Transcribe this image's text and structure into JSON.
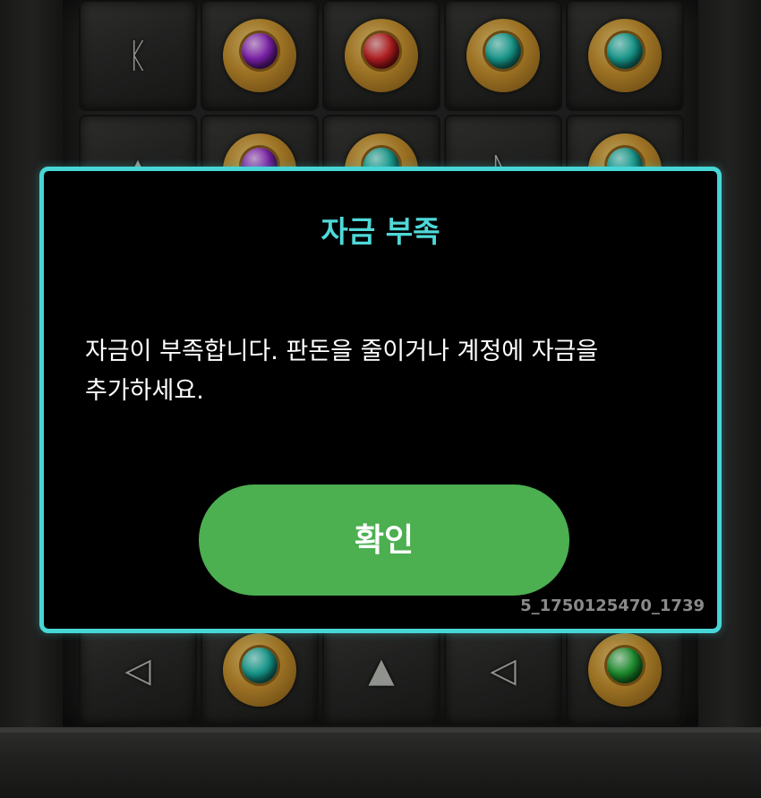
{
  "background": {
    "description_icons": [
      "rune-k-icon",
      "eye-of-horus-icon",
      "ankh-icon",
      "scarab-icon",
      "scarab-icon",
      "rune-arrow-icon"
    ],
    "row1": [
      {
        "type": "rune",
        "glyph": "ᛕ",
        "icon": "rune-k-icon"
      },
      {
        "type": "gold",
        "gem": "purple",
        "icon": "eye-of-horus-icon"
      },
      {
        "type": "gold",
        "gem": "red",
        "icon": "ankh-icon"
      },
      {
        "type": "gold",
        "gem": "teal",
        "icon": "scarab-icon"
      },
      {
        "type": "gold",
        "gem": "teal",
        "icon": "scarab-icon"
      }
    ],
    "row2": [
      {
        "type": "rune",
        "glyph": "▲",
        "icon": "rune-triangle-icon"
      },
      {
        "type": "gold",
        "gem": "purple",
        "icon": "eye-of-horus-icon"
      },
      {
        "type": "gold",
        "gem": "teal",
        "icon": "scarab-icon"
      },
      {
        "type": "rune",
        "glyph": "ᚣ",
        "icon": "rune-icon"
      },
      {
        "type": "gold",
        "gem": "teal",
        "icon": "scarab-icon"
      }
    ],
    "row_bottom": [
      {
        "type": "rune",
        "glyph": "◁",
        "icon": "rune-arrow-icon"
      },
      {
        "type": "gold",
        "gem": "teal",
        "icon": "scarab-icon"
      },
      {
        "type": "rune",
        "glyph": "▲",
        "icon": "rune-triangle-icon"
      },
      {
        "type": "rune",
        "glyph": "◁",
        "icon": "rune-arrow-icon"
      },
      {
        "type": "gold",
        "gem": "green",
        "icon": "scarab-icon"
      }
    ]
  },
  "dialog": {
    "title": "자금 부족",
    "message": "자금이 부족합니다. 판돈을 줄이거나 계정에 자금을 추가하세요.",
    "confirm_label": "확인",
    "request_id": "5_1750125470_1739"
  },
  "colors": {
    "accent_border": "#47d6d6",
    "title": "#4fd8d8",
    "button": "#4caf50",
    "button_text": "#ffffff",
    "dialog_bg": "#000000"
  }
}
